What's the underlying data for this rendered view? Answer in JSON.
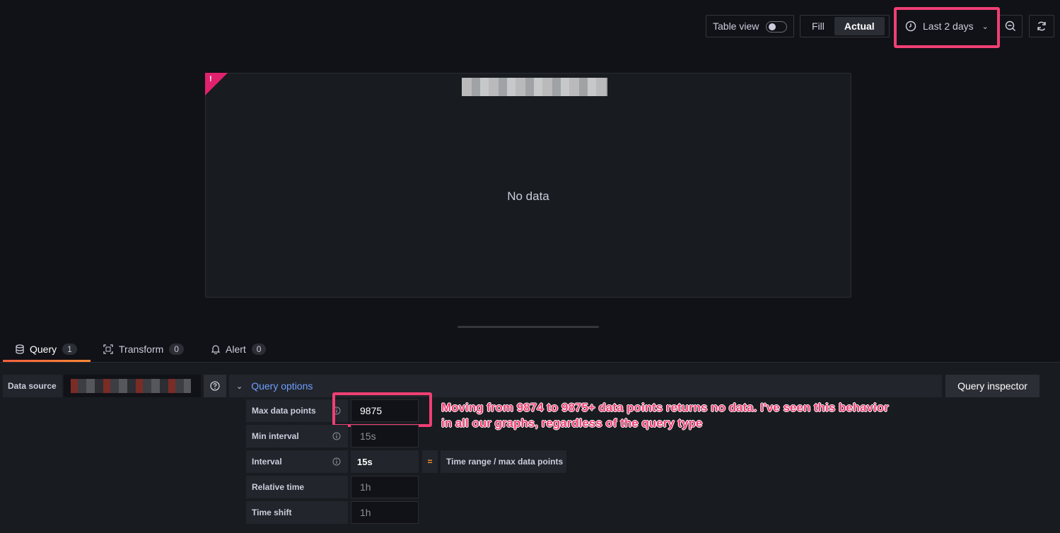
{
  "toolbar": {
    "table_view_label": "Table view",
    "fill_label": "Fill",
    "actual_label": "Actual",
    "time_range_label": "Last 2 days"
  },
  "panel": {
    "warning_mark": "!",
    "no_data_text": "No data"
  },
  "tabs": [
    {
      "label": "Query",
      "count": "1"
    },
    {
      "label": "Transform",
      "count": "0"
    },
    {
      "label": "Alert",
      "count": "0"
    }
  ],
  "query": {
    "data_source_label": "Data source",
    "query_options_label": "Query options",
    "query_inspector_label": "Query inspector"
  },
  "options": {
    "max_data_points": {
      "label": "Max data points",
      "value": "9875"
    },
    "min_interval": {
      "label": "Min interval",
      "placeholder": "15s"
    },
    "interval": {
      "label": "Interval",
      "value": "15s",
      "equals": "=",
      "derived": "Time range / max data points"
    },
    "relative_time": {
      "label": "Relative time",
      "placeholder": "1h"
    },
    "time_shift": {
      "label": "Time shift",
      "placeholder": "1h"
    }
  },
  "annotation": {
    "line1": "Moving from 9874 to 9875+ data points returns no data. I've seen this behavior",
    "line2": "in all our graphs, regardless of the query type"
  },
  "colors": {
    "background": "#111217",
    "panel": "#181b1f",
    "accent_link": "#6e9fff",
    "highlight": "#f03f74",
    "warning": "#e0226e",
    "tab_underline": "#ff8833"
  }
}
